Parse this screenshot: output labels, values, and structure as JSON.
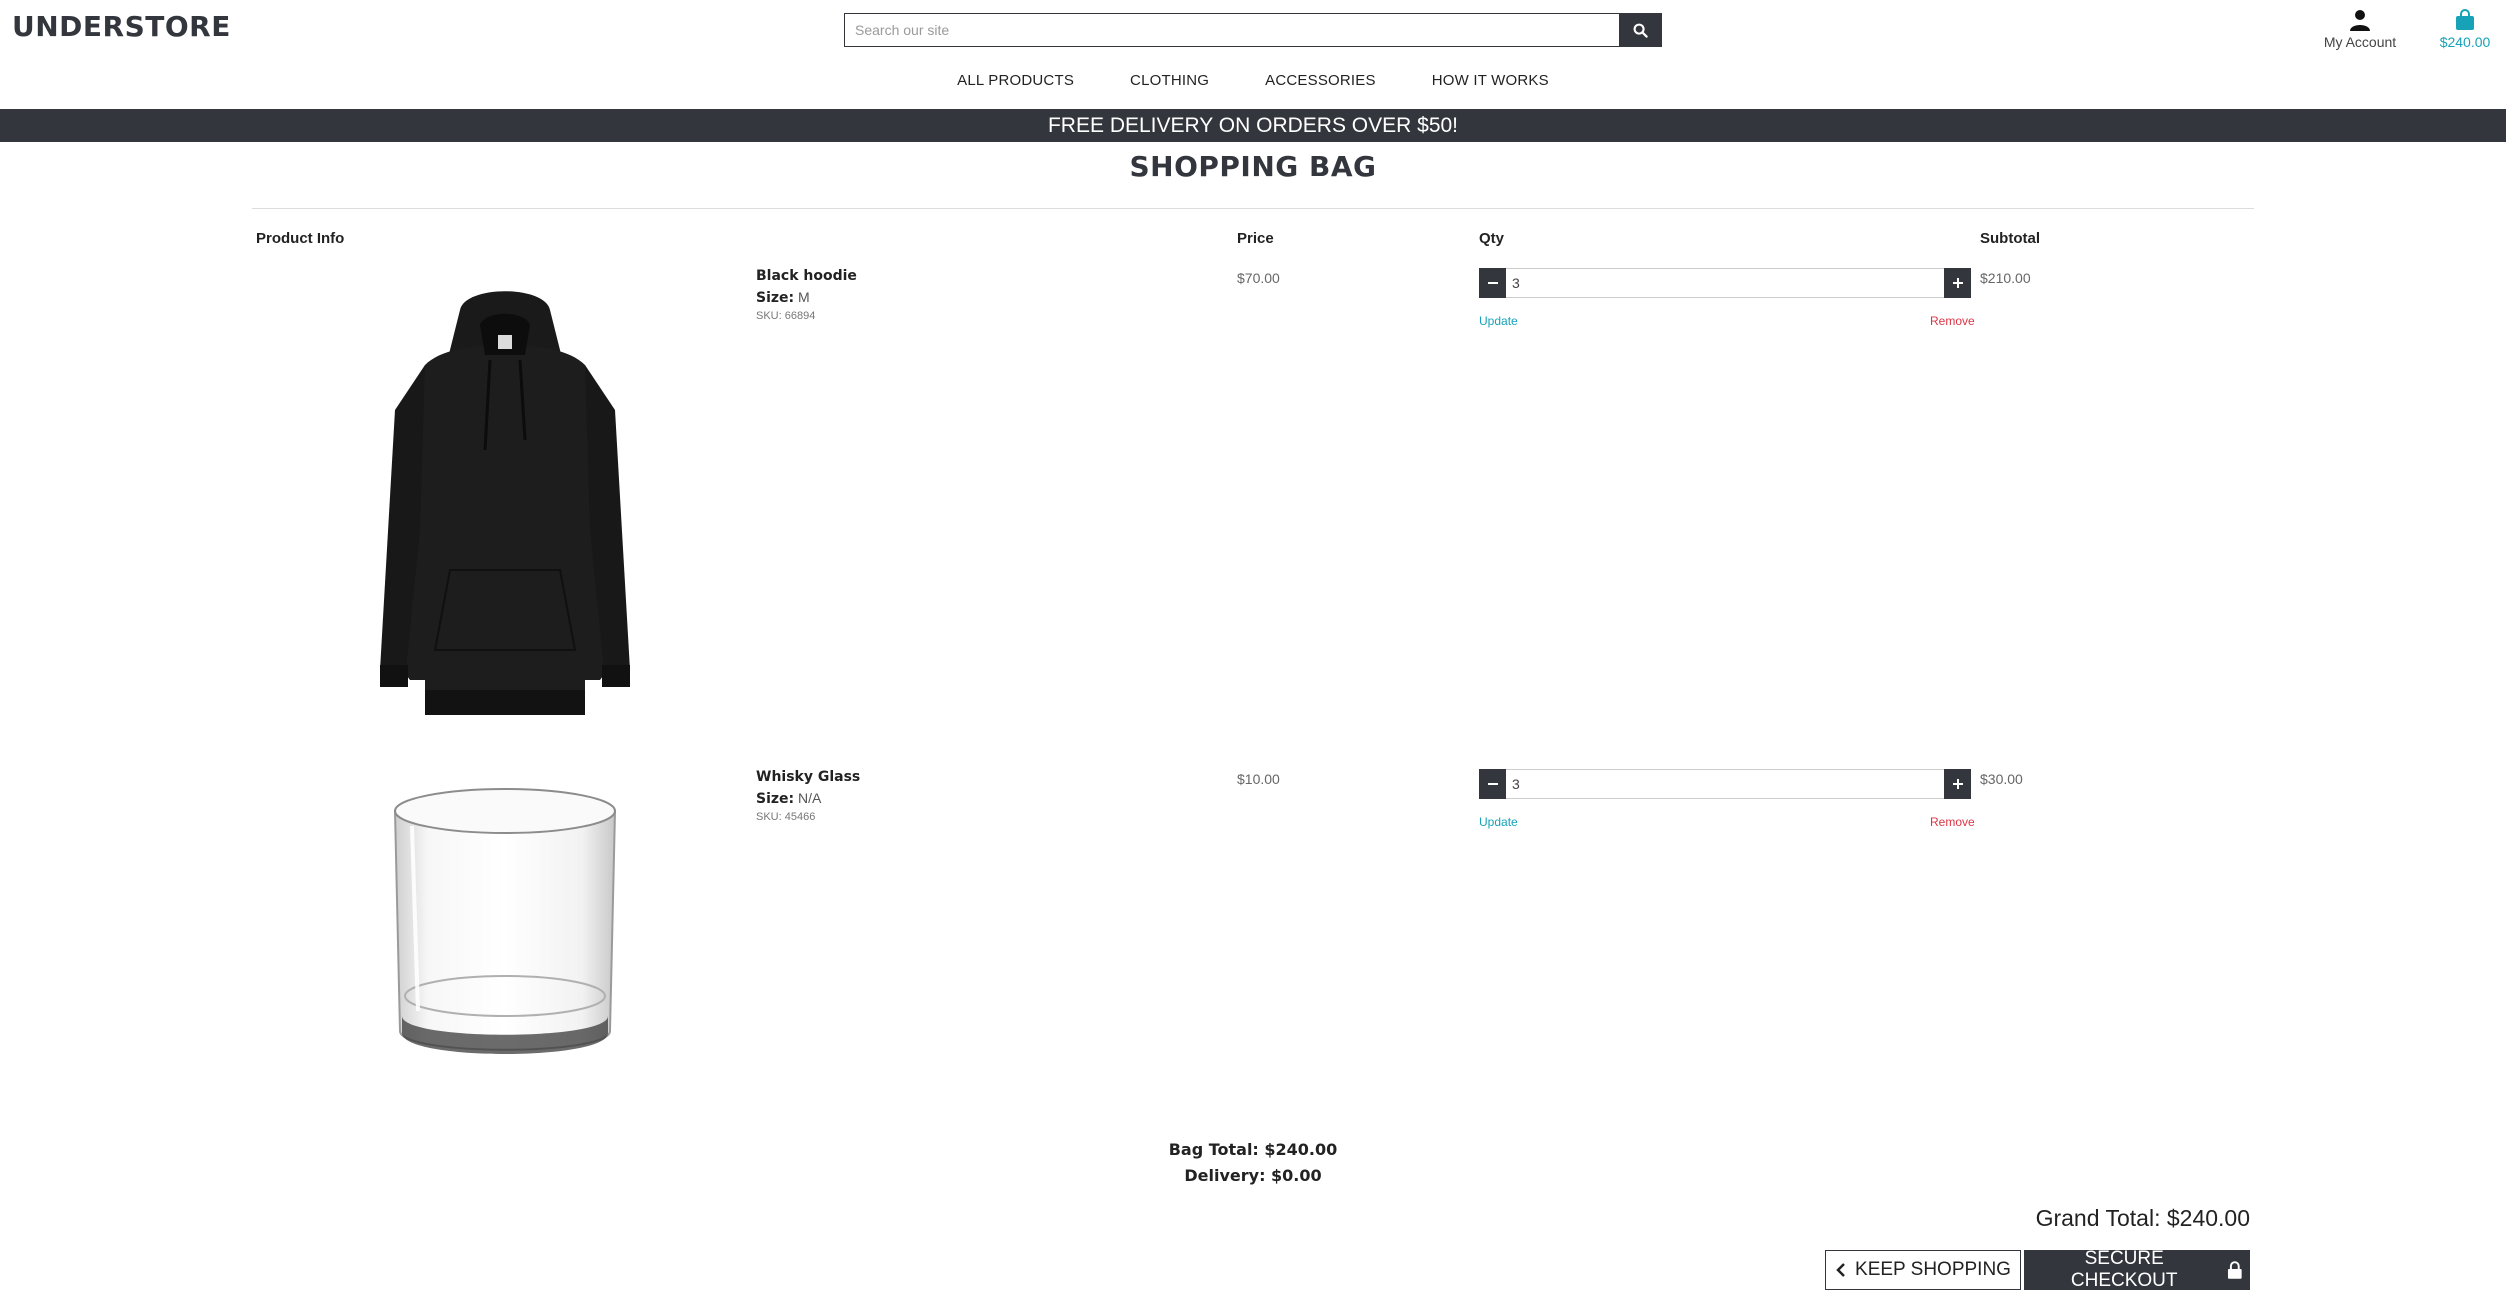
{
  "header": {
    "logo": "UNDERSTORE",
    "search_placeholder": "Search our site",
    "account_label": "My Account",
    "bag_total": "$240.00"
  },
  "nav": {
    "items": [
      "ALL PRODUCTS",
      "CLOTHING",
      "ACCESSORIES",
      "HOW IT WORKS"
    ]
  },
  "promo": "FREE DELIVERY ON ORDERS OVER $50!",
  "page_title": "SHOPPING BAG",
  "table": {
    "headers": {
      "product_info": "Product Info",
      "price": "Price",
      "qty": "Qty",
      "subtotal": "Subtotal"
    },
    "size_label": "Size:",
    "update_label": "Update",
    "remove_label": "Remove",
    "items": [
      {
        "name": "Black hoodie",
        "size": "M",
        "sku": "SKU: 66894",
        "price": "$70.00",
        "qty": "3",
        "subtotal": "$210.00"
      },
      {
        "name": "Whisky Glass",
        "size": "N/A",
        "sku": "SKU: 45466",
        "price": "$10.00",
        "qty": "3",
        "subtotal": "$30.00"
      }
    ]
  },
  "totals": {
    "bag_total": "Bag Total: $240.00",
    "delivery": "Delivery: $0.00",
    "grand_total": "Grand Total: $240.00"
  },
  "buttons": {
    "keep_shopping": "KEEP SHOPPING",
    "secure_checkout": "SECURE CHECKOUT"
  },
  "colors": {
    "dark": "#33373d",
    "accent": "#17a2b8",
    "danger": "#dc3545"
  }
}
